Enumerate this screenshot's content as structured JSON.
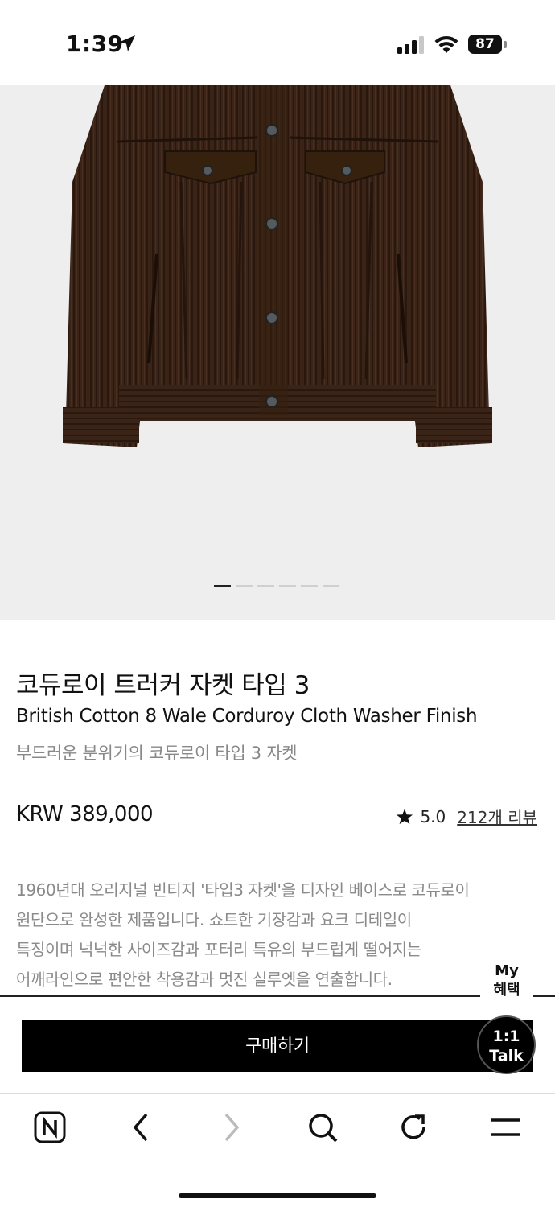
{
  "status_bar": {
    "time": "1:39",
    "battery": "87",
    "icons": [
      "location-arrow-icon",
      "signal-icon",
      "wifi-icon",
      "battery-icon"
    ]
  },
  "product": {
    "image_alt": "brown corduroy trucker jacket",
    "pager": {
      "total": 6,
      "active_index": 0
    },
    "title_ko": "코듀로이 트러커 자켓 타입 3",
    "title_en": "British Cotton 8 Wale Corduroy Cloth Washer Finish",
    "subtitle": "부드러운 분위기의 코듀로이 타입 3 자켓",
    "price": "KRW 389,000",
    "rating": "5.0",
    "reviews": "212개 리뷰",
    "description_lines": [
      "1960년대 오리지널 빈티지 '타입3 자켓'을 디자인 베이스로 코듀로이",
      "원단으로 완성한 제품입니다. 쇼트한 기장감과 요크 디테일이",
      "특징이며 넉넉한 사이즈감과 포터리 특유의 부드럽게 떨어지는",
      "어깨라인으로 편안한 착용감과 멋진 실루엣을 연출합니다."
    ]
  },
  "actions": {
    "my_benefit_line1": "My",
    "my_benefit_line2": "혜택",
    "buy_label": "구매하기",
    "talk_line1": "1:1",
    "talk_line2": "Talk"
  },
  "bottom_nav": {
    "items": [
      "naver-home-icon",
      "back-icon",
      "forward-icon",
      "search-icon",
      "refresh-icon",
      "menu-icon"
    ]
  },
  "colors": {
    "jacket": "#3b2418",
    "image_bg": "#eeeeee",
    "button_bg": "#000000",
    "muted_text": "#8a8a8a"
  }
}
